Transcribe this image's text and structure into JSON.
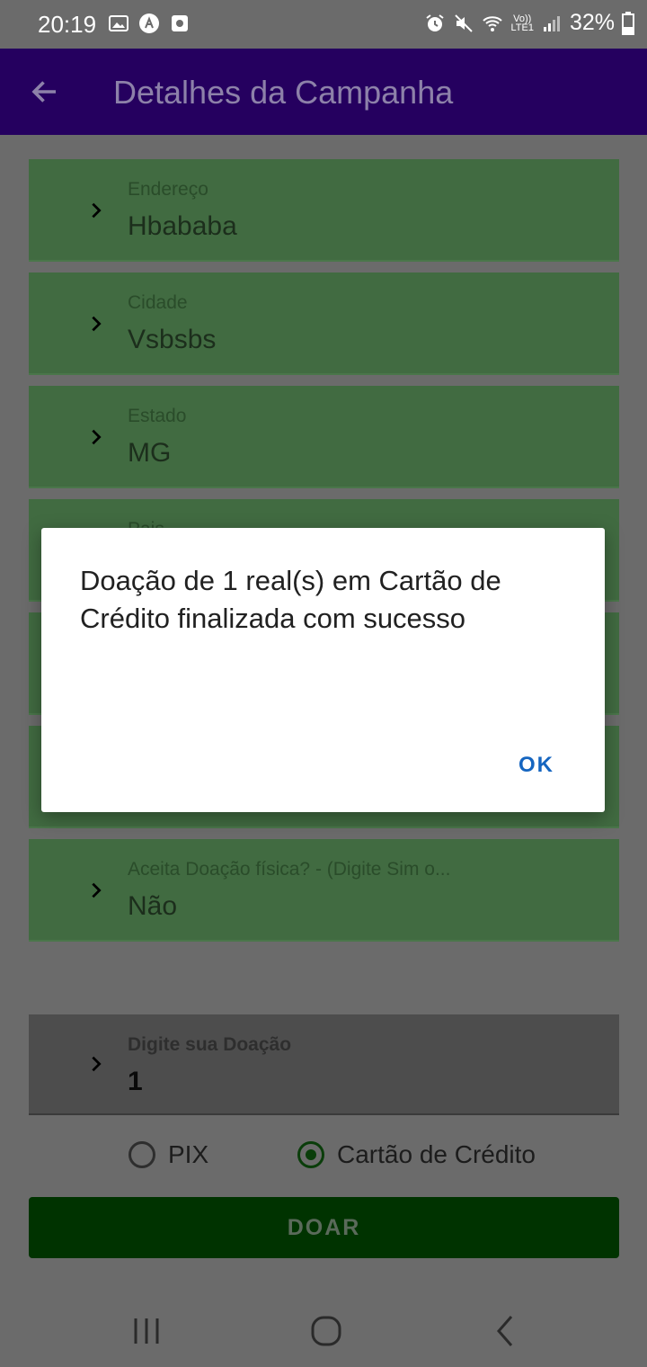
{
  "status_bar": {
    "time": "20:19",
    "battery": "32%",
    "lte_top": "Vo))",
    "lte_bottom": "LTE1"
  },
  "app_bar": {
    "title": "Detalhes da Campanha"
  },
  "fields": [
    {
      "label": "Endereço",
      "value": "Hbababa"
    },
    {
      "label": "Cidade",
      "value": "Vsbsbs"
    },
    {
      "label": "Estado",
      "value": "MG"
    },
    {
      "label": "Pais",
      "value": ""
    },
    {
      "label": "",
      "value": ""
    },
    {
      "label": "",
      "value": ""
    },
    {
      "label": "Aceita Doação física? - (Digite Sim o...",
      "value": "Não"
    }
  ],
  "donation": {
    "label": "Digite sua Doação",
    "value": "1"
  },
  "payment": {
    "option_pix": "PIX",
    "option_card": "Cartão de Crédito",
    "selected": "Cartão de Crédito"
  },
  "donate_button": "DOAR",
  "dialog": {
    "message": "Doação de 1 real(s) em Cartão de Crédito finalizada com sucesso",
    "ok_label": "OK"
  },
  "colors": {
    "app_bar": "#25005f",
    "field_bg": "#416b41",
    "button_bg": "#003300",
    "dialog_action": "#1565c0"
  }
}
